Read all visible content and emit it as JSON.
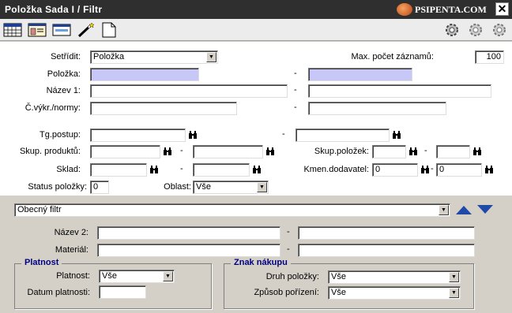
{
  "window": {
    "title": "Položka  Sada I / Filtr",
    "brand": "PSIPENTA.COM",
    "close_glyph": "✕"
  },
  "toolbar": {
    "icons": [
      "table-icon",
      "window-icon",
      "card-icon",
      "wand-icon",
      "new-page-icon"
    ],
    "right_icons": [
      "gear-icon",
      "gear-icon",
      "gear-icon"
    ]
  },
  "filter": {
    "sort_label": "Setřídit:",
    "sort_value": "Položka",
    "max_label": "Max. počet záznamů:",
    "max_value": "100",
    "item_label": "Položka:",
    "item_from": "",
    "item_to": "",
    "name1_label": "Název 1:",
    "norm_label": "Č.výkr./normy:",
    "tg_label": "Tg.postup:",
    "prodgroup_label": "Skup. produktů:",
    "itemgroup_label": "Skup.položek:",
    "warehouse_label": "Sklad:",
    "supplier_label": "Kmen.dodavatel:",
    "supplier_from": "0",
    "supplier_to": "0",
    "status_label": "Status položky:",
    "status_value": "0",
    "area_label": "Oblast:",
    "area_value": "Vše",
    "dash": "-"
  },
  "general_filter": {
    "select_value": "Obecný filtr",
    "name2_label": "Název 2:",
    "material_label": "Materiál:",
    "dash": "-"
  },
  "validity_group": {
    "title": "Platnost",
    "validity_label": "Platnost:",
    "validity_value": "Vše",
    "date_label": "Datum platnosti:",
    "date_value": ""
  },
  "purchase_group": {
    "title": "Znak nákupu",
    "type_label": "Druh položky:",
    "type_value": "Vše",
    "method_label": "Způsob pořízení:",
    "method_value": "Vše"
  },
  "colors": {
    "titlebar": "#2f2f2f",
    "highlight": "#c8c8f8",
    "panel": "#d4d0c8",
    "accent": "#1f4aa8"
  }
}
